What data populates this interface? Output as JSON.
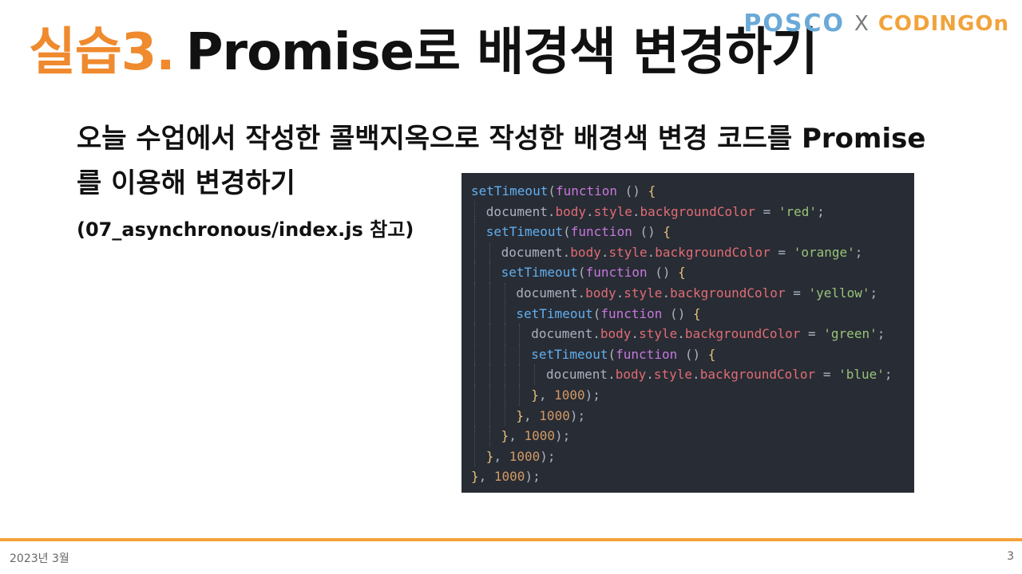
{
  "slide": {
    "title_accent": "실습3.",
    "title_main": "Promise로 배경색 변경하기",
    "instruction": "오늘 수업에서 작성한 콜백지옥으로 작성한 배경색 변경 코드를 Promise를 이용해 변경하기",
    "reference": "(07_asynchronous/index.js 참고)"
  },
  "brand": {
    "left": "POSCO",
    "separator": "X",
    "right": "CODINGOn"
  },
  "code": {
    "lines": [
      {
        "indent": 0,
        "tokens": [
          [
            "setTimeout",
            "t-fn"
          ],
          [
            "(",
            "t-pn"
          ],
          [
            "function",
            "t-kw"
          ],
          [
            " () ",
            "t-pn"
          ],
          [
            "{",
            "t-br"
          ]
        ]
      },
      {
        "indent": 1,
        "tokens": [
          [
            "document",
            "t-obj"
          ],
          [
            ".",
            "t-pn"
          ],
          [
            "body",
            "t-prop"
          ],
          [
            ".",
            "t-pn"
          ],
          [
            "style",
            "t-prop"
          ],
          [
            ".",
            "t-pn"
          ],
          [
            "backgroundColor",
            "t-prop"
          ],
          [
            " = ",
            "t-pn"
          ],
          [
            "'red'",
            "t-str"
          ],
          [
            ";",
            "t-pn"
          ]
        ]
      },
      {
        "indent": 1,
        "tokens": [
          [
            "setTimeout",
            "t-fn"
          ],
          [
            "(",
            "t-pn"
          ],
          [
            "function",
            "t-kw"
          ],
          [
            " () ",
            "t-pn"
          ],
          [
            "{",
            "t-br"
          ]
        ]
      },
      {
        "indent": 2,
        "tokens": [
          [
            "document",
            "t-obj"
          ],
          [
            ".",
            "t-pn"
          ],
          [
            "body",
            "t-prop"
          ],
          [
            ".",
            "t-pn"
          ],
          [
            "style",
            "t-prop"
          ],
          [
            ".",
            "t-pn"
          ],
          [
            "backgroundColor",
            "t-prop"
          ],
          [
            " = ",
            "t-pn"
          ],
          [
            "'orange'",
            "t-str"
          ],
          [
            ";",
            "t-pn"
          ]
        ]
      },
      {
        "indent": 2,
        "tokens": [
          [
            "setTimeout",
            "t-fn"
          ],
          [
            "(",
            "t-pn"
          ],
          [
            "function",
            "t-kw"
          ],
          [
            " () ",
            "t-pn"
          ],
          [
            "{",
            "t-br"
          ]
        ]
      },
      {
        "indent": 3,
        "tokens": [
          [
            "document",
            "t-obj"
          ],
          [
            ".",
            "t-pn"
          ],
          [
            "body",
            "t-prop"
          ],
          [
            ".",
            "t-pn"
          ],
          [
            "style",
            "t-prop"
          ],
          [
            ".",
            "t-pn"
          ],
          [
            "backgroundColor",
            "t-prop"
          ],
          [
            " = ",
            "t-pn"
          ],
          [
            "'yellow'",
            "t-str"
          ],
          [
            ";",
            "t-pn"
          ]
        ]
      },
      {
        "indent": 3,
        "tokens": [
          [
            "setTimeout",
            "t-fn"
          ],
          [
            "(",
            "t-pn"
          ],
          [
            "function",
            "t-kw"
          ],
          [
            " () ",
            "t-pn"
          ],
          [
            "{",
            "t-br"
          ]
        ]
      },
      {
        "indent": 4,
        "tokens": [
          [
            "document",
            "t-obj"
          ],
          [
            ".",
            "t-pn"
          ],
          [
            "body",
            "t-prop"
          ],
          [
            ".",
            "t-pn"
          ],
          [
            "style",
            "t-prop"
          ],
          [
            ".",
            "t-pn"
          ],
          [
            "backgroundColor",
            "t-prop"
          ],
          [
            " = ",
            "t-pn"
          ],
          [
            "'green'",
            "t-str"
          ],
          [
            ";",
            "t-pn"
          ]
        ]
      },
      {
        "indent": 4,
        "tokens": [
          [
            "setTimeout",
            "t-fn"
          ],
          [
            "(",
            "t-pn"
          ],
          [
            "function",
            "t-kw"
          ],
          [
            " () ",
            "t-pn"
          ],
          [
            "{",
            "t-br"
          ]
        ]
      },
      {
        "indent": 5,
        "tokens": [
          [
            "document",
            "t-obj"
          ],
          [
            ".",
            "t-pn"
          ],
          [
            "body",
            "t-prop"
          ],
          [
            ".",
            "t-pn"
          ],
          [
            "style",
            "t-prop"
          ],
          [
            ".",
            "t-pn"
          ],
          [
            "backgroundColor",
            "t-prop"
          ],
          [
            " = ",
            "t-pn"
          ],
          [
            "'blue'",
            "t-str"
          ],
          [
            ";",
            "t-pn"
          ]
        ]
      },
      {
        "indent": 4,
        "tokens": [
          [
            "}",
            "t-br"
          ],
          [
            ", ",
            "t-pn"
          ],
          [
            "1000",
            "t-num"
          ],
          [
            ");",
            "t-pn"
          ]
        ]
      },
      {
        "indent": 3,
        "tokens": [
          [
            "}",
            "t-br"
          ],
          [
            ", ",
            "t-pn"
          ],
          [
            "1000",
            "t-num"
          ],
          [
            ");",
            "t-pn"
          ]
        ]
      },
      {
        "indent": 2,
        "tokens": [
          [
            "}",
            "t-br"
          ],
          [
            ", ",
            "t-pn"
          ],
          [
            "1000",
            "t-num"
          ],
          [
            ");",
            "t-pn"
          ]
        ]
      },
      {
        "indent": 1,
        "tokens": [
          [
            "}",
            "t-br"
          ],
          [
            ", ",
            "t-pn"
          ],
          [
            "1000",
            "t-num"
          ],
          [
            ");",
            "t-pn"
          ]
        ]
      },
      {
        "indent": 0,
        "tokens": [
          [
            "}",
            "t-br"
          ],
          [
            ", ",
            "t-pn"
          ],
          [
            "1000",
            "t-num"
          ],
          [
            ");",
            "t-pn"
          ]
        ]
      }
    ]
  },
  "footer": {
    "date": "2023년 3월",
    "page": "3"
  },
  "colors": {
    "accent": "#ef8a2e",
    "footer_rule": "#f5a13a",
    "code_bg": "#282c34"
  }
}
